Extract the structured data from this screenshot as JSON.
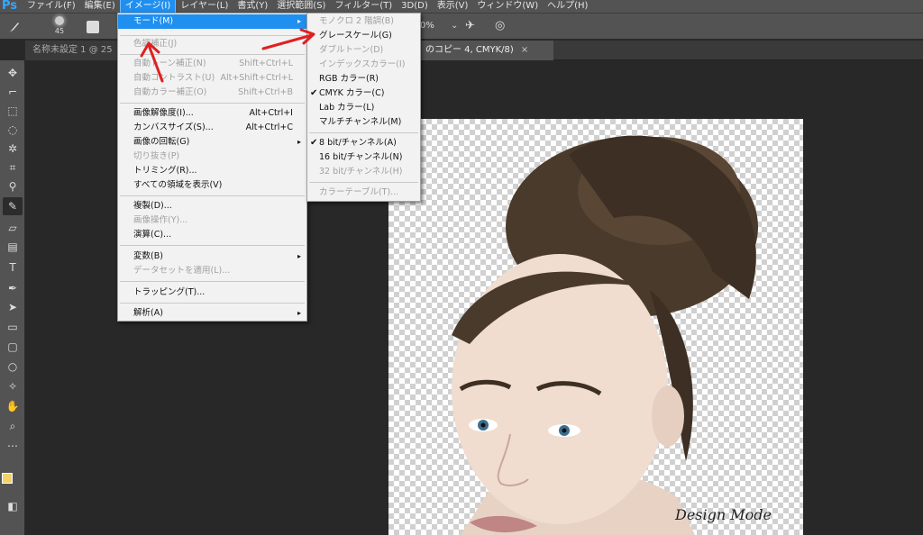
{
  "app": {
    "logo": "Ps"
  },
  "menubar": {
    "items": [
      "ファイル(F)",
      "編集(E)",
      "イメージ(I)",
      "レイヤー(L)",
      "書式(Y)",
      "選択範囲(S)",
      "フィルター(T)",
      "3D(D)",
      "表示(V)",
      "ウィンドウ(W)",
      "ヘルプ(H)"
    ],
    "active_index": 2
  },
  "options": {
    "brush_size": "45",
    "opacity": "0%"
  },
  "tabs": [
    {
      "label": "名称未設定 1 @ 25"
    },
    {
      "label": "のコピー 4, CMYK/8)",
      "close": "×"
    }
  ],
  "image_menu": {
    "items": [
      {
        "label": "モード(M)",
        "shortcut": "",
        "arrow": "▸",
        "state": "highlighted"
      },
      {
        "label": "色調補正(J)",
        "shortcut": "",
        "arrow": "",
        "state": "disabled"
      },
      {
        "label": "自動トーン補正(N)",
        "shortcut": "Shift+Ctrl+L",
        "arrow": "",
        "state": "disabled"
      },
      {
        "label": "自動コントラスト(U)",
        "shortcut": "Alt+Shift+Ctrl+L",
        "arrow": "",
        "state": "disabled"
      },
      {
        "label": "自動カラー補正(O)",
        "shortcut": "Shift+Ctrl+B",
        "arrow": "",
        "state": "disabled"
      },
      {
        "label": "画像解像度(I)...",
        "shortcut": "Alt+Ctrl+I",
        "arrow": "",
        "state": "enabled"
      },
      {
        "label": "カンバスサイズ(S)...",
        "shortcut": "Alt+Ctrl+C",
        "arrow": "",
        "state": "enabled"
      },
      {
        "label": "画像の回転(G)",
        "shortcut": "",
        "arrow": "▸",
        "state": "enabled"
      },
      {
        "label": "切り抜き(P)",
        "shortcut": "",
        "arrow": "",
        "state": "disabled"
      },
      {
        "label": "トリミング(R)...",
        "shortcut": "",
        "arrow": "",
        "state": "enabled"
      },
      {
        "label": "すべての領域を表示(V)",
        "shortcut": "",
        "arrow": "",
        "state": "enabled"
      },
      {
        "label": "複製(D)...",
        "shortcut": "",
        "arrow": "",
        "state": "enabled"
      },
      {
        "label": "画像操作(Y)...",
        "shortcut": "",
        "arrow": "",
        "state": "disabled"
      },
      {
        "label": "演算(C)...",
        "shortcut": "",
        "arrow": "",
        "state": "enabled"
      },
      {
        "label": "変数(B)",
        "shortcut": "",
        "arrow": "▸",
        "state": "enabled"
      },
      {
        "label": "データセットを適用(L)...",
        "shortcut": "",
        "arrow": "",
        "state": "disabled"
      },
      {
        "label": "トラッピング(T)...",
        "shortcut": "",
        "arrow": "",
        "state": "enabled"
      },
      {
        "label": "解析(A)",
        "shortcut": "",
        "arrow": "▸",
        "state": "enabled"
      }
    ]
  },
  "mode_menu": {
    "items": [
      {
        "label": "モノクロ 2 階調(B)",
        "checked": false,
        "state": "disabled"
      },
      {
        "label": "グレースケール(G)",
        "checked": false,
        "state": "enabled"
      },
      {
        "label": "ダブルトーン(D)",
        "checked": false,
        "state": "disabled"
      },
      {
        "label": "インデックスカラー(I)",
        "checked": false,
        "state": "disabled"
      },
      {
        "label": "RGB カラー(R)",
        "checked": false,
        "state": "enabled"
      },
      {
        "label": "CMYK カラー(C)",
        "checked": true,
        "state": "enabled"
      },
      {
        "label": "Lab カラー(L)",
        "checked": false,
        "state": "enabled"
      },
      {
        "label": "マルチチャンネル(M)",
        "checked": false,
        "state": "enabled"
      },
      {
        "label": "8 bit/チャンネル(A)",
        "checked": true,
        "state": "enabled"
      },
      {
        "label": "16 bit/チャンネル(N)",
        "checked": false,
        "state": "enabled"
      },
      {
        "label": "32 bit/チャンネル(H)",
        "checked": false,
        "state": "disabled"
      },
      {
        "label": "カラーテーブル(T)...",
        "checked": false,
        "state": "disabled"
      }
    ],
    "check_glyph": "✔"
  },
  "canvas": {
    "signature": "Design Mode"
  },
  "colors": {
    "foreground": "#f2d36b",
    "background": "#000000",
    "accent": "#1f8ff0",
    "annotation": "#e02020"
  },
  "tools": [
    "move-icon",
    "artboard-icon",
    "marquee-icon",
    "lasso-icon",
    "magic-wand-icon",
    "crop-icon",
    "eyedropper-icon",
    "brush-icon",
    "eraser-icon",
    "gradient-icon",
    "type-icon",
    "pen-icon",
    "path-select-icon",
    "rectangle-icon",
    "rounded-rect-icon",
    "ellipse-icon",
    "custom-shape-icon",
    "hand-icon",
    "zoom-icon",
    "more-tools-icon"
  ]
}
